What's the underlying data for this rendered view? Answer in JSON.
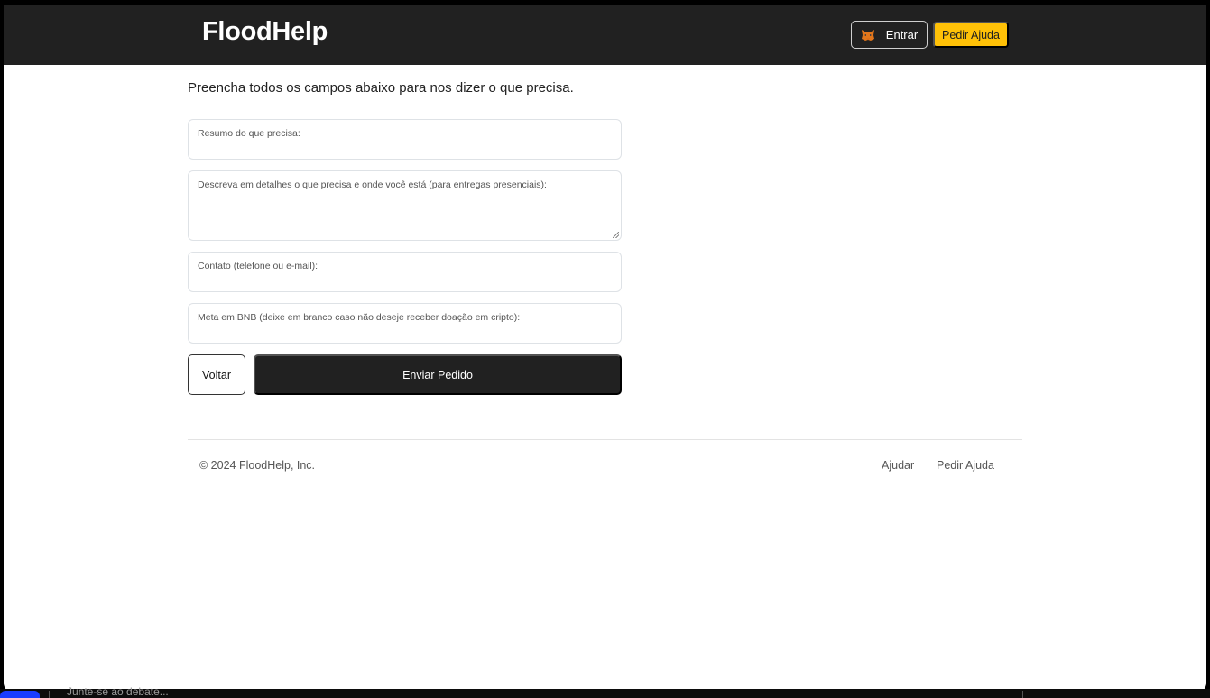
{
  "navbar": {
    "brand": "FloodHelp",
    "login_label": "Entrar",
    "login_icon": "metamask-fox-icon",
    "request_label": "Pedir Ajuda",
    "accent_color": "#ffc107",
    "bg_color": "#212121"
  },
  "form": {
    "intro": "Preencha todos os campos abaixo para nos dizer o que precisa.",
    "summary_label": "Resumo do que precisa:",
    "details_label": "Descreva em detalhes o que precisa e onde você está (para entregas presenciais):",
    "contact_label": "Contato (telefone ou e-mail):",
    "goal_label": "Meta em BNB (deixe em branco caso não deseje receber doação em cripto):",
    "back_label": "Voltar",
    "submit_label": "Enviar Pedido"
  },
  "footer": {
    "copyright": "© 2024 FloodHelp, Inc.",
    "links": [
      "Ajudar",
      "Pedir Ajuda"
    ]
  },
  "background": {
    "partial_text": "Junte-se ao debate..."
  }
}
